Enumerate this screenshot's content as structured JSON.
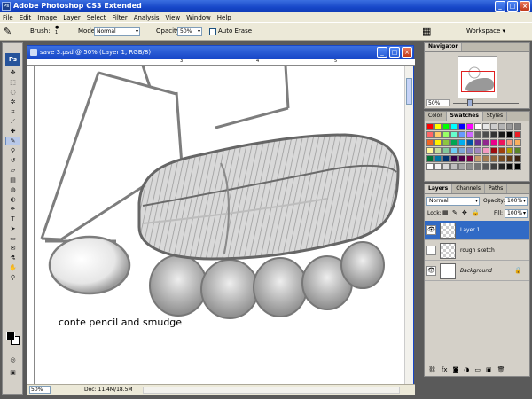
{
  "app": {
    "title": "Adobe Photoshop CS3 Extended",
    "icon": "ps-app-icon",
    "logo": "Ps"
  },
  "window_controls": {
    "minimize": "_",
    "maximize": "□",
    "close": "×"
  },
  "menu": [
    "File",
    "Edit",
    "Image",
    "Layer",
    "Select",
    "Filter",
    "Analysis",
    "View",
    "Window",
    "Help"
  ],
  "options": {
    "brush_label": "Brush:",
    "brush_size": "1",
    "mode_label": "Mode:",
    "mode_value": "Normal",
    "opacity_label": "Opacity:",
    "opacity_value": "50%",
    "auto_erase_label": "Auto Erase",
    "workspace_label": "Workspace ▾"
  },
  "document": {
    "title": "save 3.psd @ 50% (Layer 1, RGB/8)",
    "caption": "conte pencil and smudge",
    "zoom": "50%",
    "doc_info": "Doc: 11.4M/18.5M",
    "ruler_numbers": [
      "3",
      "4",
      "5"
    ]
  },
  "navigator": {
    "tab": "Navigator",
    "zoom": "50%"
  },
  "color_panel": {
    "tabs": [
      "Color",
      "Swatches",
      "Styles"
    ],
    "active": "Swatches",
    "swatches": [
      "#ff0000",
      "#ffff00",
      "#00ff00",
      "#00ffff",
      "#0000ff",
      "#ff00ff",
      "#ffffff",
      "#e6e6e6",
      "#cccccc",
      "#b3b3b3",
      "#999999",
      "#808080",
      "#ff6666",
      "#ffcc66",
      "#99ff66",
      "#66ffcc",
      "#6699ff",
      "#cc66ff",
      "#666666",
      "#4d4d4d",
      "#333333",
      "#1a1a1a",
      "#000000",
      "#ed1c24",
      "#f26522",
      "#fff200",
      "#8dc63f",
      "#00a651",
      "#00aeef",
      "#0054a6",
      "#662d91",
      "#92278f",
      "#ec008c",
      "#ed145b",
      "#f7977a",
      "#fbaf5d",
      "#fff799",
      "#c4df9b",
      "#82ca9c",
      "#6dcff6",
      "#7da7d9",
      "#8781bd",
      "#a186be",
      "#f49ac2",
      "#9e0b0f",
      "#a0410d",
      "#aba000",
      "#598527",
      "#007236",
      "#0076a3",
      "#003471",
      "#32004b",
      "#4b0049",
      "#7b0046",
      "#c69c6d",
      "#a67c52",
      "#8c6239",
      "#754c24",
      "#603913",
      "#3c2415",
      "#ffffff",
      "#f2f2f2",
      "#d9d9d9",
      "#bfbfbf",
      "#a6a6a6",
      "#8c8c8c",
      "#737373",
      "#595959",
      "#404040",
      "#262626",
      "#0d0d0d",
      "#000000"
    ]
  },
  "layers_panel": {
    "tabs": [
      "Layers",
      "Channels",
      "Paths"
    ],
    "active": "Layers",
    "blend_mode": "Normal",
    "opacity_label": "Opacity:",
    "opacity_value": "100%",
    "lock_label": "Lock:",
    "fill_label": "Fill:",
    "fill_value": "100%",
    "layers": [
      {
        "name": "Layer 1",
        "visible": true,
        "selected": true
      },
      {
        "name": "rough sketch",
        "visible": false,
        "selected": false
      },
      {
        "name": "Background",
        "visible": true,
        "selected": false,
        "locked": true
      }
    ],
    "footer_icons": [
      "link-icon",
      "fx-icon",
      "mask-icon",
      "adjustment-icon",
      "folder-icon",
      "new-layer-icon",
      "trash-icon"
    ]
  }
}
